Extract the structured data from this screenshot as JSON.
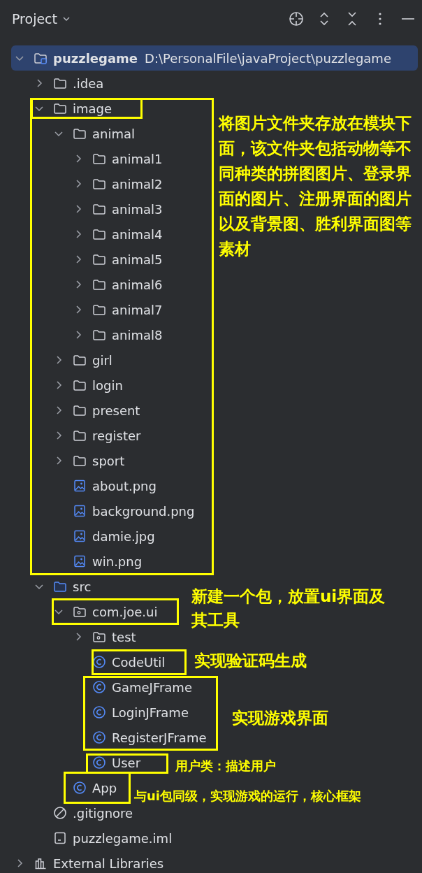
{
  "panel": {
    "title": "Project"
  },
  "tree": [
    {
      "label": "puzzlegame",
      "path": "D:\\PersonalFile\\javaProject\\puzzlegame",
      "kind": "module",
      "expanded": true,
      "selected": true,
      "children": [
        {
          "label": ".idea",
          "kind": "folder",
          "expanded": false,
          "selected": false
        },
        {
          "label": "image",
          "kind": "folder",
          "expanded": true,
          "selected": false,
          "children": [
            {
              "label": "animal",
              "kind": "folder",
              "expanded": true,
              "selected": false,
              "children": [
                {
                  "label": "animal1",
                  "kind": "folder",
                  "expanded": false,
                  "selected": false
                },
                {
                  "label": "animal2",
                  "kind": "folder",
                  "expanded": false,
                  "selected": false
                },
                {
                  "label": "animal3",
                  "kind": "folder",
                  "expanded": false,
                  "selected": false
                },
                {
                  "label": "animal4",
                  "kind": "folder",
                  "expanded": false,
                  "selected": false
                },
                {
                  "label": "animal5",
                  "kind": "folder",
                  "expanded": false,
                  "selected": false
                },
                {
                  "label": "animal6",
                  "kind": "folder",
                  "expanded": false,
                  "selected": false
                },
                {
                  "label": "animal7",
                  "kind": "folder",
                  "expanded": false,
                  "selected": false
                },
                {
                  "label": "animal8",
                  "kind": "folder",
                  "expanded": false,
                  "selected": false
                }
              ]
            },
            {
              "label": "girl",
              "kind": "folder",
              "expanded": false,
              "selected": false
            },
            {
              "label": "login",
              "kind": "folder",
              "expanded": false,
              "selected": false
            },
            {
              "label": "present",
              "kind": "folder",
              "expanded": false,
              "selected": false
            },
            {
              "label": "register",
              "kind": "folder",
              "expanded": false,
              "selected": false
            },
            {
              "label": "sport",
              "kind": "folder",
              "expanded": false,
              "selected": false
            },
            {
              "label": "about.png",
              "kind": "image",
              "selected": false
            },
            {
              "label": "background.png",
              "kind": "image",
              "selected": false
            },
            {
              "label": "damie.jpg",
              "kind": "image",
              "selected": false
            },
            {
              "label": "win.png",
              "kind": "image",
              "selected": false
            }
          ]
        },
        {
          "label": "src",
          "kind": "source",
          "expanded": true,
          "selected": false,
          "children": [
            {
              "label": "com.joe.ui",
              "kind": "package",
              "expanded": true,
              "selected": false,
              "children": [
                {
                  "label": "test",
                  "kind": "package",
                  "expanded": false,
                  "selected": false
                },
                {
                  "label": "CodeUtil",
                  "kind": "class",
                  "selected": false
                },
                {
                  "label": "GameJFrame",
                  "kind": "class",
                  "selected": false
                },
                {
                  "label": "LoginJFrame",
                  "kind": "class",
                  "selected": false
                },
                {
                  "label": "RegisterJFrame",
                  "kind": "class",
                  "selected": false
                },
                {
                  "label": "User",
                  "kind": "class",
                  "selected": false
                }
              ]
            },
            {
              "label": "App",
              "kind": "class",
              "selected": false
            }
          ]
        },
        {
          "label": ".gitignore",
          "kind": "ignore",
          "selected": false
        },
        {
          "label": "puzzlegame.iml",
          "kind": "iml",
          "selected": false
        }
      ]
    },
    {
      "label": "External Libraries",
      "kind": "libraries",
      "expanded": false,
      "selected": false
    }
  ],
  "annotations": [
    {
      "text": "将图片文件夹存放在模块下面，该文件夹包括动物等不同种类的拼图图片、登录界面的图片、注册界面的图片以及背景图、胜利界面图等素材"
    },
    {
      "text": "新建一个包，放置ui界面及其工具"
    },
    {
      "text": "实现验证码生成"
    },
    {
      "text": "实现游戏界面"
    },
    {
      "text": "用户类：描述用户"
    },
    {
      "text": "与ui包同级，实现游戏的运行，核心框架"
    }
  ]
}
